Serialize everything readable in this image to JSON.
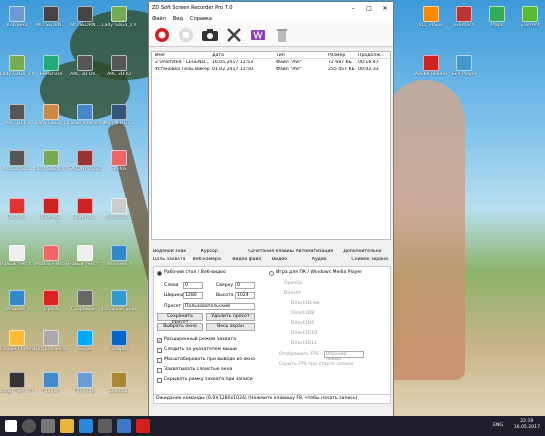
{
  "desktop": {
    "icons": [
      {
        "label": "Корзина",
        "color": "#6a9bd6"
      },
      {
        "label": "MO SEDRN...",
        "color": "#444"
      },
      {
        "label": "MO SEDRN...",
        "color": "#444"
      },
      {
        "label": "Lady GaGa_1 MO...",
        "color": "#7a5"
      },
      {
        "label": "Lady GaGa_1 MO...",
        "color": "#7a5"
      },
      {
        "label": "FeelShare",
        "color": "#2a7"
      },
      {
        "label": "ARC 3D DR...",
        "color": "#555"
      },
      {
        "label": "ARC 3D IO",
        "color": "#555"
      },
      {
        "label": "ARC 3D IO",
        "color": "#555"
      },
      {
        "label": "Lady GaGa_1",
        "color": "#c84"
      },
      {
        "label": "Lasso Interactivy",
        "color": "#48c"
      },
      {
        "label": "Mail M-HG7...",
        "color": "#357"
      },
      {
        "label": "ARC 3D SD...",
        "color": "#555"
      },
      {
        "label": "Lady GaGa_1 MO...",
        "color": "#7a5"
      },
      {
        "label": "SARDNI VIDEO",
        "color": "#933"
      },
      {
        "label": "Firefox",
        "color": "#e66"
      },
      {
        "label": "Cent-W...",
        "color": "#d33"
      },
      {
        "label": "DrweryLi...",
        "color": "#c22"
      },
      {
        "label": "DrweryLi...",
        "color": "#c22"
      },
      {
        "label": "Word.Com...",
        "color": "#ccc"
      },
      {
        "label": "Новый текст...",
        "color": "#eee"
      },
      {
        "label": "Mozilla Firefox",
        "color": "#e66"
      },
      {
        "label": "Новый текст...",
        "color": "#eee"
      },
      {
        "label": "Windows 7",
        "color": "#38c"
      },
      {
        "label": "Windows 7",
        "color": "#38c"
      },
      {
        "label": "Opera",
        "color": "#d22"
      },
      {
        "label": "Скорпион...",
        "color": "#666"
      },
      {
        "label": "Lobacuon Bookstore",
        "color": "#39c"
      },
      {
        "label": "Google Chrome",
        "color": "#fb3"
      },
      {
        "label": "Шпаргалка Windows 7",
        "color": "#aaa"
      },
      {
        "label": "Skype",
        "color": "#0af"
      },
      {
        "label": "Gadgets",
        "color": "#06c"
      },
      {
        "label": "Codec Tweak Tool",
        "color": "#333"
      },
      {
        "label": "Лоалюм",
        "color": "#48c"
      },
      {
        "label": "Computer",
        "color": "#6a9bd6"
      },
      {
        "label": "Calendar",
        "color": "#a83"
      },
      {
        "label": "VLC Player",
        "color": "#f80"
      },
      {
        "label": "Jivemach",
        "color": "#b33"
      },
      {
        "label": "Maps",
        "color": "#3a5"
      },
      {
        "label": "uTorrent",
        "color": "#5b3"
      },
      {
        "label": "Adobe Reader",
        "color": "#c22"
      },
      {
        "label": "SEV Player",
        "color": "#49c"
      }
    ],
    "watermark": "sp-pkasimusyldesktops.com"
  },
  "window": {
    "title": "ZD Soft Screen Recorder Pro 7.0",
    "menu": [
      "Файл",
      "Вид",
      "Справка"
    ],
    "toolbar_icons": [
      "record-icon",
      "stop-icon",
      "camera-icon",
      "tools-icon",
      "video-icon",
      "trash-icon"
    ],
    "list": {
      "headers": [
        "Имя",
        "Дата",
        "Тип",
        "Размер",
        "Продолж..."
      ],
      "rows": [
        [
          "2 Unlimited - LEGEND...",
          "16.05.2017 11:53",
          "Файл \"AVI\"",
          "72 687 KБ",
          "00:16:47"
        ],
        [
          "Установка Телы Викер",
          "01.02.2017 11:50",
          "Файл \"AVI\"",
          "255 457 KБ",
          "00:02:33"
        ]
      ]
    },
    "tabs": {
      "row1": [
        "Водяной знак",
        "Курсор",
        "Сочетания клавиш",
        "Автоматизация",
        "Дополнительно"
      ],
      "row2": [
        "Цель захвата",
        "Веб-камера",
        "Видео файл",
        "Видео",
        "Аудио",
        "Снимок экрана"
      ],
      "active": "Цель захвата"
    },
    "capture": {
      "radio_desktop": "Рабочий стол / Веб-видео",
      "radio_game": "Игра для ПК / Windows Media Player",
      "left_label": "Слева",
      "left_value": "0",
      "top_label": "Сверху",
      "top_value": "0",
      "width_label": "Ширина",
      "width_value": "1280",
      "height_label": "Высота",
      "height_value": "1024",
      "preset_label": "Пресет",
      "preset_value": "Пользовательский",
      "save_preset": "Сохранить пресет",
      "delete_preset": "Удалить пресет",
      "select_area": "Выбрать окно",
      "full_screen": "Весь экран",
      "checkboxes": [
        {
          "label": "Расширенный режим захвата",
          "checked": true
        },
        {
          "label": "Следить за указателем мыши",
          "checked": false
        },
        {
          "label": "Масштабировать при выводе из окна",
          "checked": false
        },
        {
          "label": "Захватывать слоистые окна",
          "checked": false
        },
        {
          "label": "Скрывать рамку захвата при записи",
          "checked": false
        }
      ],
      "game_options": [
        "OpenGL",
        "DirectX",
        "Direct3Draw",
        "Direct3D8",
        "Direct3D9",
        "Direct3D10",
        "Direct3D11"
      ],
      "display_fps_label": "Отображать FPS",
      "display_fps_value": "Верхний левый",
      "hide_fps": "Скрыть FPS при старте записи"
    },
    "status": "Ожидание команды (0,0)(1280x1024) (Нажмите клавишу F8, чтобы начать запись)"
  },
  "taskbar": {
    "lang": "ENG",
    "time": "22:19",
    "date": "16.05.2017"
  }
}
